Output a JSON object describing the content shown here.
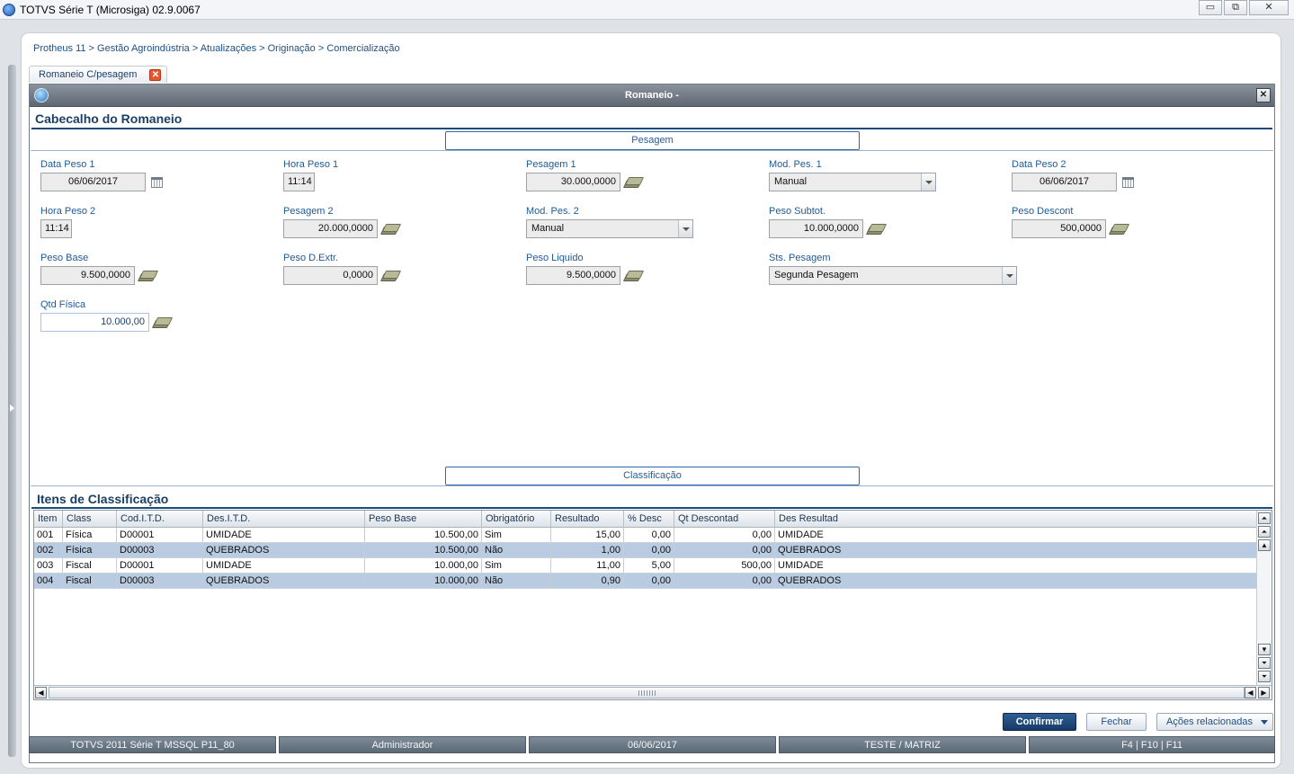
{
  "os_window": {
    "title": "TOTVS Série T  (Microsiga) 02.9.0067",
    "minimize": "▭",
    "maximize": "⧉",
    "close": "✕"
  },
  "breadcrumb": "Protheus 11 > Gestão Agroindústria > Atualizações > Originação > Comercialização",
  "tabs": [
    {
      "label": "Romaneio C/pesagem",
      "close": "✕"
    }
  ],
  "dialog": {
    "title": "Romaneio -",
    "close": "✕"
  },
  "header_section": {
    "title": "Cabecalho do Romaneio",
    "group_tab": "Pesagem"
  },
  "fields": {
    "data_peso_1": {
      "label": "Data Peso 1",
      "value": "06/06/2017"
    },
    "hora_peso_1": {
      "label": "Hora Peso 1",
      "value": "11:14"
    },
    "pesagem_1": {
      "label": "Pesagem 1",
      "value": "30.000,0000"
    },
    "mod_pes_1": {
      "label": "Mod. Pes. 1",
      "value": "Manual"
    },
    "data_peso_2": {
      "label": "Data Peso 2",
      "value": "06/06/2017"
    },
    "hora_peso_2": {
      "label": "Hora Peso 2",
      "value": "11:14"
    },
    "pesagem_2": {
      "label": "Pesagem 2",
      "value": "20.000,0000"
    },
    "mod_pes_2": {
      "label": "Mod. Pes. 2",
      "value": "Manual"
    },
    "peso_subtot": {
      "label": "Peso Subtot.",
      "value": "10.000,0000"
    },
    "peso_descont": {
      "label": "Peso Descont",
      "value": "500,0000"
    },
    "peso_base": {
      "label": "Peso Base",
      "value": "9.500,0000"
    },
    "peso_d_extr": {
      "label": "Peso D.Extr.",
      "value": "0,0000"
    },
    "peso_liquido": {
      "label": "Peso Liquido",
      "value": "9.500,0000"
    },
    "sts_pesagem": {
      "label": "Sts. Pesagem",
      "value": "Segunda Pesagem"
    },
    "qtd_fisica": {
      "label": "Qtd Física",
      "value": "10.000,00"
    }
  },
  "classification_section": {
    "group_tab": "Classificação",
    "title": "Itens de Classificação"
  },
  "grid": {
    "columns": [
      "Item",
      "Class",
      "Cod.I.T.D.",
      "Des.I.T.D.",
      "Peso Base",
      "Obrigatório",
      "Resultado",
      "% Desc",
      "Qt Descontad",
      "Des Resultad"
    ],
    "rows": [
      [
        "001",
        "Física",
        "D00001",
        "UMIDADE",
        "10.500,00",
        "Sim",
        "15,00",
        "0,00",
        "0,00",
        "UMIDADE"
      ],
      [
        "002",
        "Física",
        "D00003",
        "QUEBRADOS",
        "10.500,00",
        "Não",
        "1,00",
        "0,00",
        "0,00",
        "QUEBRADOS"
      ],
      [
        "003",
        "Fiscal",
        "D00001",
        "UMIDADE",
        "10.000,00",
        "Sim",
        "11,00",
        "5,00",
        "500,00",
        "UMIDADE"
      ],
      [
        "004",
        "Fiscal",
        "D00003",
        "QUEBRADOS",
        "10.000,00",
        "Não",
        "0,90",
        "0,00",
        "0,00",
        "QUEBRADOS"
      ]
    ],
    "scroll_glyphs": {
      "top": "⏶",
      "page_up": "⏶",
      "up": "▲",
      "down": "▼",
      "page_down": "⏷",
      "bottom": "⏷",
      "left": "◀",
      "right": "▶"
    }
  },
  "buttons": {
    "confirm": "Confirmar",
    "close": "Fechar",
    "related_actions": "Ações relacionadas"
  },
  "statusbar": {
    "system": "TOTVS 2011 Série T  MSSQL P11_80",
    "user": "Administrador",
    "date": "06/06/2017",
    "company": "TESTE / MATRIZ",
    "shortcuts": "F4 | F10 | F11"
  }
}
